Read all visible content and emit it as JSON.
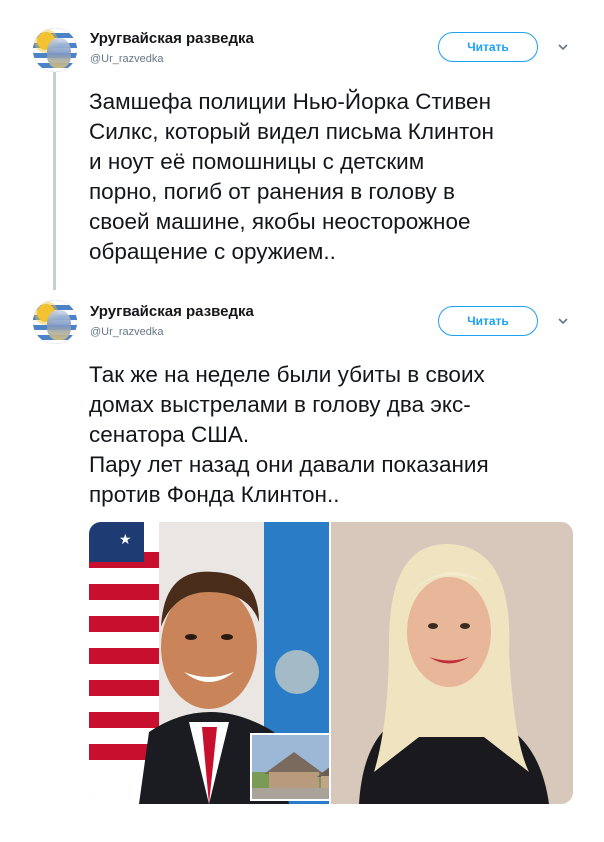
{
  "tweets": [
    {
      "user": {
        "name": "Уругвайская разведка",
        "handle": "@Ur_razvedka"
      },
      "follow_label": "Читать",
      "text": "Замшефа полиции Нью-Йорка Стивен\nСилкс, который видел письма Клинтон\nи ноут её помошницы с детским\nпорно, погиб от ранения в голову в\nсвоей машине, якобы неосторожное\nобращение с оружием.."
    },
    {
      "user": {
        "name": "Уругвайская разведка",
        "handle": "@Ur_razvedka"
      },
      "follow_label": "Читать",
      "text": "Так же на неделе были убиты в своих\nдомах выстрелами в голову два экс-\nсенатора США.\nПару лет назад они давали показания\nпротив Фонда Клинтон.."
    }
  ],
  "colors": {
    "accent": "#1da1f2",
    "thread_line": "#c4cfd6",
    "muted": "#657786"
  },
  "icons": [
    "chevron-down-icon",
    "avatar"
  ]
}
